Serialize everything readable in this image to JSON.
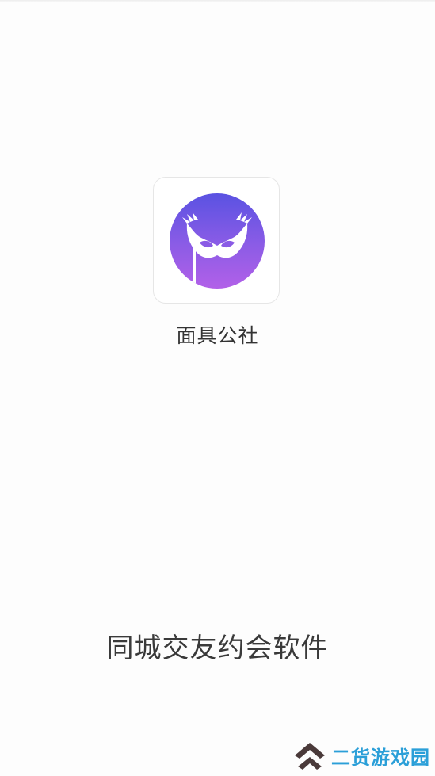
{
  "splash": {
    "app_name": "面具公社",
    "slogan": "同城交友约会软件",
    "icon": "mask-icon",
    "icon_gradient": [
      "#5a52e2",
      "#b260e8"
    ]
  },
  "watermark": {
    "text": "二货游戏园",
    "icon": "double-chevron-up-icon",
    "text_color": "#2b9fd8",
    "logo_color": "#4a3a3a"
  }
}
